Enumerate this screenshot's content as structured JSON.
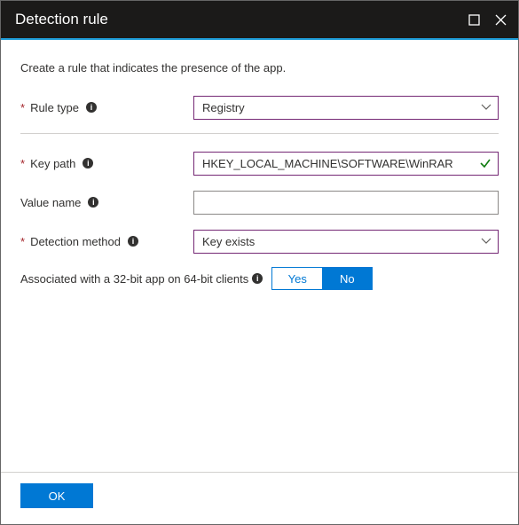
{
  "header": {
    "title": "Detection rule"
  },
  "instruction": "Create a rule that indicates the presence of the app.",
  "fields": {
    "ruleType": {
      "label": "Rule type",
      "value": "Registry"
    },
    "keyPath": {
      "label": "Key path",
      "value": "HKEY_LOCAL_MACHINE\\SOFTWARE\\WinRAR"
    },
    "valueName": {
      "label": "Value name",
      "value": ""
    },
    "detectionMethod": {
      "label": "Detection method",
      "value": "Key exists"
    },
    "assoc32": {
      "label": "Associated with a 32-bit app on 64-bit clients",
      "yes": "Yes",
      "no": "No",
      "selected": "No"
    }
  },
  "footer": {
    "ok": "OK"
  }
}
